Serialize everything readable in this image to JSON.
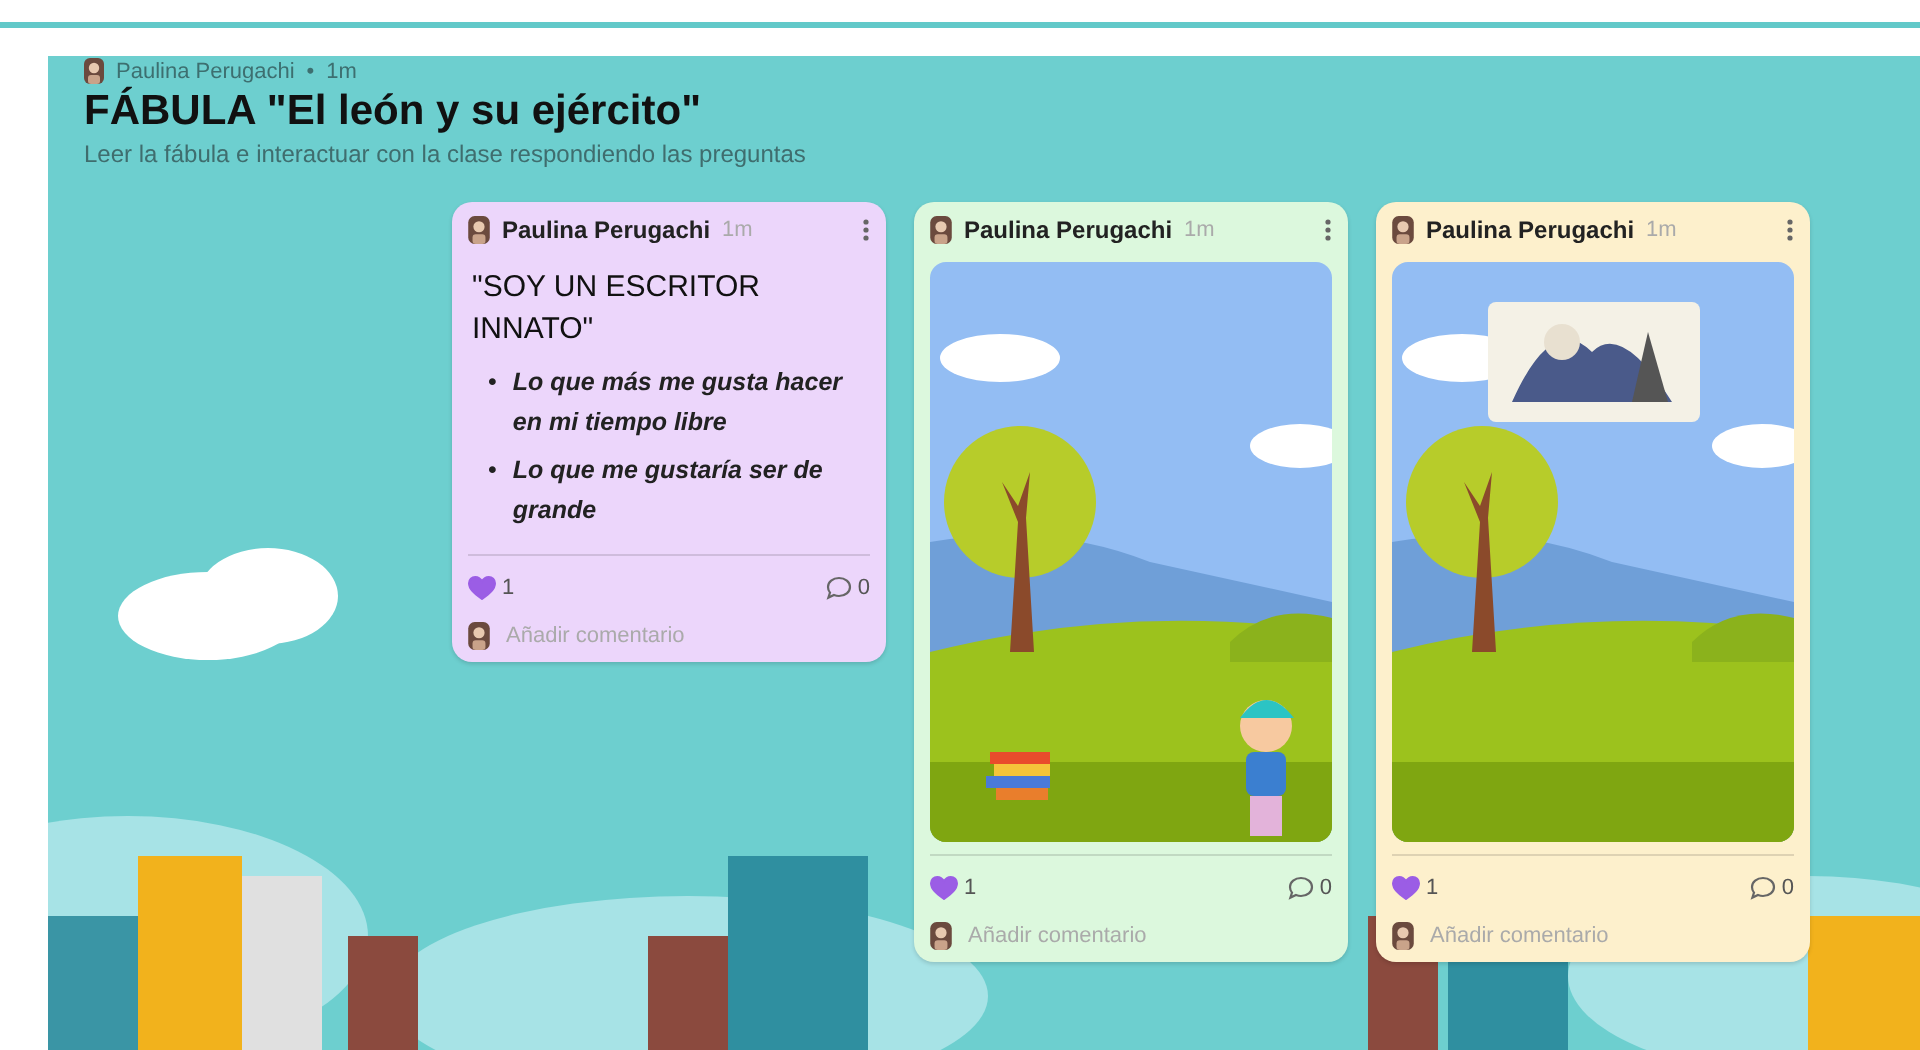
{
  "board": {
    "author": "Paulina Perugachi",
    "separator": "•",
    "time": "1m",
    "title": "FÁBULA \"El león y su ejército\"",
    "description": "Leer la fábula e interactuar con la clase respondiendo las preguntas"
  },
  "posts": [
    {
      "kind": "text",
      "author": "Paulina Perugachi",
      "time": "1m",
      "color": "#ecd6fb",
      "heading": "\"SOY UN ESCRITOR INNATO\"",
      "bullet_marker": "•",
      "bullets": [
        "Lo que más me gusta hacer en mi tiempo libre",
        "Lo que me gustaría ser de grande"
      ],
      "liked": true,
      "likes": "1",
      "comments": "0",
      "comment_placeholder": "Añadir comentario"
    },
    {
      "kind": "image",
      "author": "Paulina Perugachi",
      "time": "1m",
      "color": "#dcf8dd",
      "inset_picture": false,
      "liked": true,
      "likes": "1",
      "comments": "0",
      "comment_placeholder": "Añadir comentario"
    },
    {
      "kind": "image",
      "author": "Paulina Perugachi",
      "time": "1m",
      "color": "#fdf0cc",
      "inset_picture": true,
      "liked": true,
      "likes": "1",
      "comments": "0",
      "comment_placeholder": "Añadir comentario"
    }
  ]
}
